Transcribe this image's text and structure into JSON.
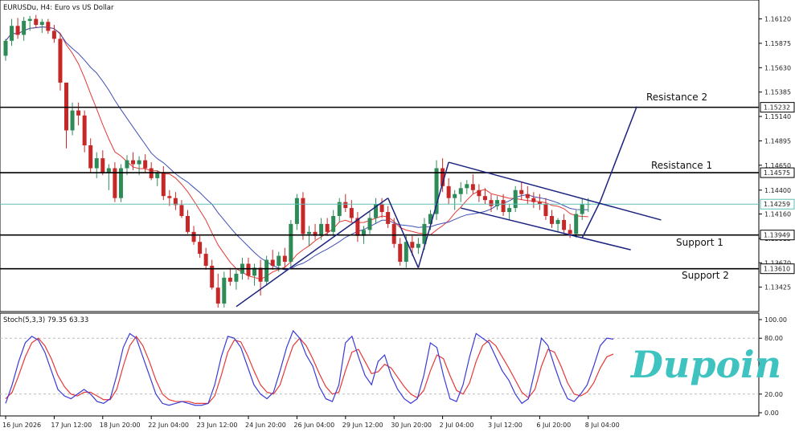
{
  "chart_data": {
    "type": "candlestick",
    "title": "EURUSDu, H4:  Euro vs US Dollar",
    "symbol": "EURUSDu",
    "timeframe": "H4",
    "description": "Euro vs US Dollar",
    "price_axis": {
      "ylim": [
        1.1318,
        1.1631
      ],
      "ticks": [
        1.1612,
        1.15875,
        1.1563,
        1.15385,
        1.1514,
        1.14895,
        1.1465,
        1.144,
        1.1416,
        1.13915,
        1.1367,
        1.13425
      ],
      "tick_labels": [
        "1.16120",
        "1.15875",
        "1.15630",
        "1.15385",
        "1.15140",
        "1.14895",
        "1.14650",
        "1.14400",
        "1.14160",
        "1.13915",
        "1.13670",
        "1.13425"
      ]
    },
    "time_axis": {
      "labels": [
        "16 Jun 2026",
        "17 Jun 12:00",
        "18 Jun 20:00",
        "22 Jun 04:00",
        "23 Jun 12:00",
        "24 Jun 20:00",
        "26 Jun 04:00",
        "29 Jun 12:00",
        "30 Jun 20:00",
        "2 Jul 04:00",
        "3 Jul 12:00",
        "6 Jul 20:00",
        "8 Jul 04:00"
      ],
      "bar_index": [
        0,
        8,
        16,
        24,
        32,
        40,
        48,
        56,
        64,
        72,
        80,
        88,
        96
      ]
    },
    "levels": [
      {
        "name": "Resistance 2",
        "price": 1.15232,
        "label": "1.15232"
      },
      {
        "name": "Resistance 1",
        "price": 1.14575,
        "label": "1.14575"
      },
      {
        "name": "Support 1",
        "price": 1.13949,
        "label": "1.13949"
      },
      {
        "name": "Support 2",
        "price": 1.1361,
        "label": "1.13610"
      }
    ],
    "current_price": {
      "price": 1.14259,
      "label": "1.14259"
    },
    "candles": [
      [
        1.1575,
        1.1592,
        1.157,
        1.159
      ],
      [
        1.159,
        1.1612,
        1.1585,
        1.1605
      ],
      [
        1.1605,
        1.1613,
        1.1592,
        1.1596
      ],
      [
        1.1596,
        1.1614,
        1.159,
        1.161
      ],
      [
        1.161,
        1.1615,
        1.16,
        1.1612
      ],
      [
        1.1612,
        1.1616,
        1.1603,
        1.1606
      ],
      [
        1.1606,
        1.1612,
        1.1598,
        1.1609
      ],
      [
        1.1609,
        1.1612,
        1.1597,
        1.16
      ],
      [
        1.16,
        1.1606,
        1.1588,
        1.1592
      ],
      [
        1.1592,
        1.1597,
        1.154,
        1.1548
      ],
      [
        1.1548,
        1.1535,
        1.1482,
        1.15
      ],
      [
        1.15,
        1.1528,
        1.1495,
        1.152
      ],
      [
        1.152,
        1.1528,
        1.1505,
        1.1515
      ],
      [
        1.1515,
        1.152,
        1.1478,
        1.1485
      ],
      [
        1.1485,
        1.1492,
        1.1458,
        1.1462
      ],
      [
        1.1462,
        1.1478,
        1.1452,
        1.1472
      ],
      [
        1.1472,
        1.148,
        1.1455,
        1.1458
      ],
      [
        1.1458,
        1.1466,
        1.144,
        1.1462
      ],
      [
        1.1462,
        1.1468,
        1.1428,
        1.1432
      ],
      [
        1.1432,
        1.1466,
        1.1428,
        1.1462
      ],
      [
        1.1462,
        1.1475,
        1.1455,
        1.147
      ],
      [
        1.147,
        1.1478,
        1.146,
        1.1466
      ],
      [
        1.1466,
        1.1474,
        1.1455,
        1.147
      ],
      [
        1.147,
        1.1476,
        1.1458,
        1.1462
      ],
      [
        1.1462,
        1.1468,
        1.145,
        1.1452
      ],
      [
        1.1452,
        1.146,
        1.1444,
        1.1458
      ],
      [
        1.1458,
        1.1464,
        1.143,
        1.1434
      ],
      [
        1.1434,
        1.144,
        1.1424,
        1.1432
      ],
      [
        1.1432,
        1.1438,
        1.142,
        1.1425
      ],
      [
        1.1425,
        1.143,
        1.1412,
        1.1414
      ],
      [
        1.1414,
        1.142,
        1.1396,
        1.1398
      ],
      [
        1.1398,
        1.1404,
        1.1385,
        1.1388
      ],
      [
        1.1388,
        1.1394,
        1.1372,
        1.1376
      ],
      [
        1.1376,
        1.1382,
        1.136,
        1.1364
      ],
      [
        1.1364,
        1.137,
        1.134,
        1.1342
      ],
      [
        1.1342,
        1.1356,
        1.1322,
        1.1326
      ],
      [
        1.1326,
        1.1358,
        1.1322,
        1.1352
      ],
      [
        1.1352,
        1.1362,
        1.1344,
        1.1348
      ],
      [
        1.1348,
        1.136,
        1.134,
        1.1356
      ],
      [
        1.1356,
        1.1372,
        1.135,
        1.1366
      ],
      [
        1.1366,
        1.1372,
        1.135,
        1.1354
      ],
      [
        1.1354,
        1.1366,
        1.1344,
        1.1362
      ],
      [
        1.1362,
        1.137,
        1.1334,
        1.1348
      ],
      [
        1.1348,
        1.1374,
        1.1344,
        1.137
      ],
      [
        1.137,
        1.138,
        1.136,
        1.1364
      ],
      [
        1.1364,
        1.1378,
        1.1358,
        1.1374
      ],
      [
        1.1374,
        1.1382,
        1.1362,
        1.1368
      ],
      [
        1.1368,
        1.141,
        1.1362,
        1.1406
      ],
      [
        1.1406,
        1.1436,
        1.14,
        1.1432
      ],
      [
        1.1432,
        1.1438,
        1.139,
        1.1396
      ],
      [
        1.1396,
        1.1404,
        1.1384,
        1.1398
      ],
      [
        1.1398,
        1.1406,
        1.139,
        1.1394
      ],
      [
        1.1394,
        1.1412,
        1.139,
        1.1406
      ],
      [
        1.1406,
        1.1412,
        1.1394,
        1.1398
      ],
      [
        1.1398,
        1.142,
        1.1394,
        1.1414
      ],
      [
        1.1414,
        1.1432,
        1.1408,
        1.1428
      ],
      [
        1.1428,
        1.1436,
        1.1418,
        1.1422
      ],
      [
        1.1422,
        1.143,
        1.1408,
        1.1412
      ],
      [
        1.1412,
        1.1418,
        1.1388,
        1.1394
      ],
      [
        1.1394,
        1.1404,
        1.1386,
        1.14
      ],
      [
        1.14,
        1.1418,
        1.1396,
        1.1412
      ],
      [
        1.1412,
        1.1432,
        1.1406,
        1.1426
      ],
      [
        1.1426,
        1.1432,
        1.1412,
        1.1418
      ],
      [
        1.1418,
        1.1424,
        1.1402,
        1.1406
      ],
      [
        1.1406,
        1.1412,
        1.1382,
        1.1386
      ],
      [
        1.1386,
        1.1392,
        1.1364,
        1.1368
      ],
      [
        1.1368,
        1.1394,
        1.1362,
        1.1388
      ],
      [
        1.1388,
        1.1394,
        1.1374,
        1.1382
      ],
      [
        1.1382,
        1.1392,
        1.1376,
        1.1386
      ],
      [
        1.1386,
        1.1412,
        1.138,
        1.1406
      ],
      [
        1.1406,
        1.142,
        1.14,
        1.1416
      ],
      [
        1.1416,
        1.147,
        1.141,
        1.1462
      ],
      [
        1.1462,
        1.1472,
        1.1438,
        1.1444
      ],
      [
        1.1444,
        1.1452,
        1.1426,
        1.1432
      ],
      [
        1.1432,
        1.144,
        1.142,
        1.1436
      ],
      [
        1.1436,
        1.1448,
        1.1428,
        1.1442
      ],
      [
        1.1442,
        1.145,
        1.1436,
        1.1446
      ],
      [
        1.1446,
        1.1456,
        1.1436,
        1.144
      ],
      [
        1.144,
        1.1446,
        1.1428,
        1.1434
      ],
      [
        1.1434,
        1.1442,
        1.1426,
        1.143
      ],
      [
        1.143,
        1.1436,
        1.1418,
        1.1424
      ],
      [
        1.1424,
        1.1434,
        1.142,
        1.143
      ],
      [
        1.143,
        1.1436,
        1.1414,
        1.1418
      ],
      [
        1.1418,
        1.1426,
        1.141,
        1.1422
      ],
      [
        1.1422,
        1.1444,
        1.1418,
        1.144
      ],
      [
        1.144,
        1.1448,
        1.143,
        1.1436
      ],
      [
        1.1436,
        1.1444,
        1.1426,
        1.1432
      ],
      [
        1.1432,
        1.1438,
        1.1422,
        1.1428
      ],
      [
        1.1428,
        1.1436,
        1.142,
        1.1426
      ],
      [
        1.1426,
        1.1432,
        1.141,
        1.1414
      ],
      [
        1.1414,
        1.142,
        1.1402,
        1.1406
      ],
      [
        1.1406,
        1.1412,
        1.1398,
        1.141
      ],
      [
        1.141,
        1.1416,
        1.1396,
        1.14
      ],
      [
        1.14,
        1.1406,
        1.1392,
        1.1396
      ],
      [
        1.1396,
        1.142,
        1.1392,
        1.1416
      ],
      [
        1.1416,
        1.1432,
        1.141,
        1.1426
      ],
      [
        1.1426,
        1.1432,
        1.1418,
        1.1426
      ]
    ],
    "stochastic": {
      "label": "Stoch(5,3,3) 79.35 63.33",
      "params": "5,3,3",
      "main_value": 79.35,
      "signal_value": 63.33,
      "ylim": [
        0,
        100
      ],
      "tick_labels": [
        "100.00",
        "80.00",
        "20.00",
        "0.00"
      ],
      "levels": [
        80,
        20
      ],
      "main": [
        10,
        30,
        55,
        75,
        82,
        78,
        65,
        45,
        25,
        18,
        15,
        20,
        25,
        20,
        12,
        10,
        15,
        40,
        70,
        85,
        80,
        60,
        40,
        20,
        10,
        8,
        10,
        12,
        10,
        8,
        8,
        10,
        30,
        60,
        82,
        80,
        70,
        50,
        30,
        20,
        15,
        22,
        45,
        70,
        88,
        80,
        62,
        50,
        28,
        15,
        12,
        30,
        75,
        82,
        60,
        40,
        30,
        55,
        62,
        40,
        25,
        15,
        10,
        15,
        40,
        75,
        70,
        40,
        15,
        12,
        30,
        60,
        85,
        80,
        75,
        60,
        45,
        35,
        20,
        10,
        15,
        45,
        80,
        72,
        50,
        30,
        15,
        12,
        20,
        30,
        50,
        72,
        80,
        79
      ],
      "signal": [
        15,
        22,
        40,
        60,
        75,
        80,
        72,
        58,
        40,
        28,
        20,
        18,
        22,
        22,
        18,
        14,
        14,
        25,
        50,
        72,
        82,
        72,
        55,
        35,
        20,
        14,
        12,
        12,
        12,
        10,
        10,
        10,
        18,
        40,
        65,
        78,
        76,
        62,
        45,
        30,
        22,
        20,
        30,
        52,
        72,
        80,
        72,
        58,
        42,
        28,
        20,
        22,
        45,
        65,
        68,
        55,
        42,
        44,
        52,
        48,
        38,
        28,
        20,
        16,
        24,
        45,
        62,
        58,
        40,
        24,
        20,
        32,
        55,
        72,
        78,
        72,
        60,
        48,
        35,
        22,
        16,
        25,
        50,
        68,
        65,
        50,
        32,
        20,
        18,
        22,
        32,
        48,
        60,
        63
      ]
    },
    "annotations": [
      "Resistance 2",
      "Resistance 1",
      "Support 1",
      "Support 2"
    ],
    "colors": {
      "bull_candle": "#2e8b57",
      "bear_candle": "#c62828",
      "ma_fast": "#e53935",
      "ma_slow": "#3f51b5",
      "trendline": "#1a237e",
      "level_line": "#000000",
      "current_price_line": "#5fbfb8",
      "stoch_main": "#3a3ad6",
      "stoch_signal": "#e53935"
    }
  },
  "branding": {
    "logo_text": "Dupoin",
    "logo_color": "#3ec3c0"
  }
}
